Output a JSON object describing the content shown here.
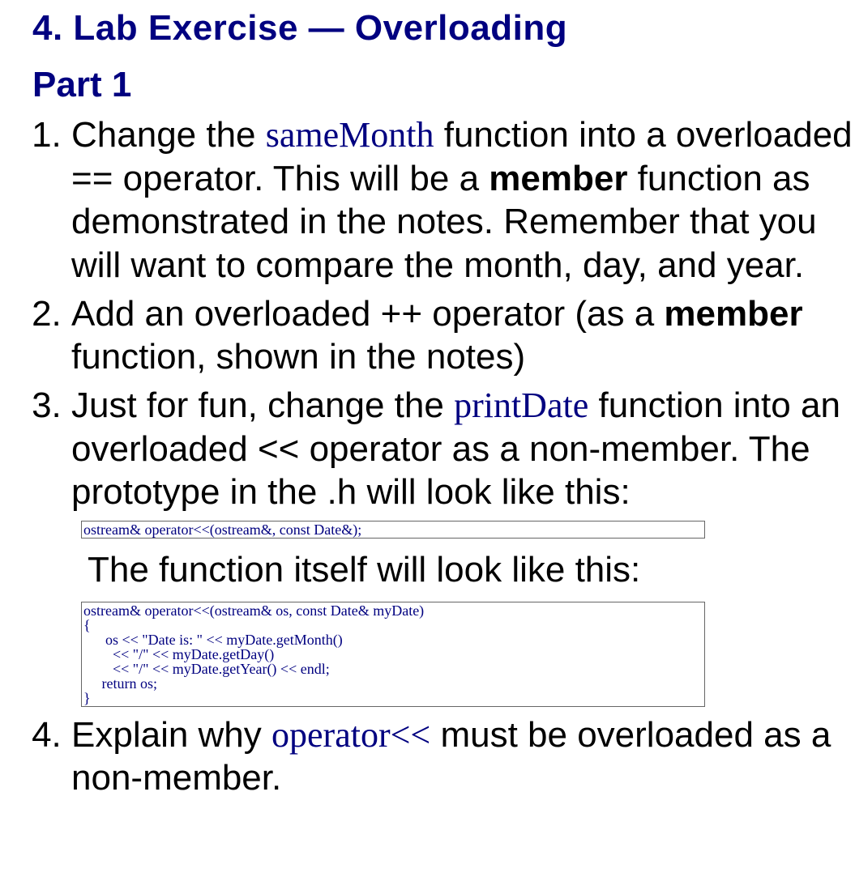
{
  "heading": "4. Lab Exercise — Overloading",
  "subheading": "Part 1",
  "items": {
    "i1": {
      "t1": "Change the ",
      "code": "sameMonth",
      "t2": " function into a overloaded == operator. This will be a ",
      "bold": "member",
      "t3": " function as demonstrated in the notes. Remember that you will want to compare the month, day, and year."
    },
    "i2": {
      "t1": "Add an overloaded ++ operator (as a ",
      "bold": "member",
      "t2": " function, shown in the notes)"
    },
    "i3": {
      "t1": "Just for fun, change the ",
      "code": "printDate",
      "t2": " function into an overloaded << operator as a non-member. The prototype in the .h will look like this:",
      "codebox1": "ostream& operator<<(ostream&, const Date&);",
      "para": "The function itself will look like this:",
      "codebox2": "ostream& operator<<(ostream& os, const Date& myDate)\n{\n      os << \"Date is: \" << myDate.getMonth()\n        << \"/\" << myDate.getDay()\n        << \"/\" << myDate.getYear() << endl;\n     return os;\n}"
    },
    "i4": {
      "t1": "Explain why ",
      "code": "operator<<",
      "t2": " must be overloaded as a non-member."
    }
  }
}
